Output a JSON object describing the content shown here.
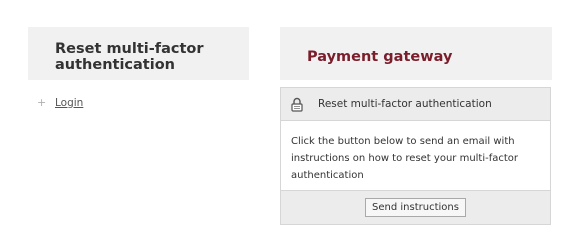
{
  "left_panel": {
    "title": "Reset multi-factor authentication",
    "nav_links": [
      {
        "icon": "plus-icon",
        "label": "Login"
      }
    ]
  },
  "right_panel": {
    "title": "Payment gateway",
    "card": {
      "icon": "lock-icon",
      "title": "Reset multi-factor authentication",
      "description": "Click the button below to send an email with instructions on how to reset your multi-factor authentication",
      "button_label": "Send instructions"
    }
  },
  "colors": {
    "panel_bg": "#f1f1f1",
    "accent_title": "#7a1e2c",
    "text": "#333333"
  }
}
